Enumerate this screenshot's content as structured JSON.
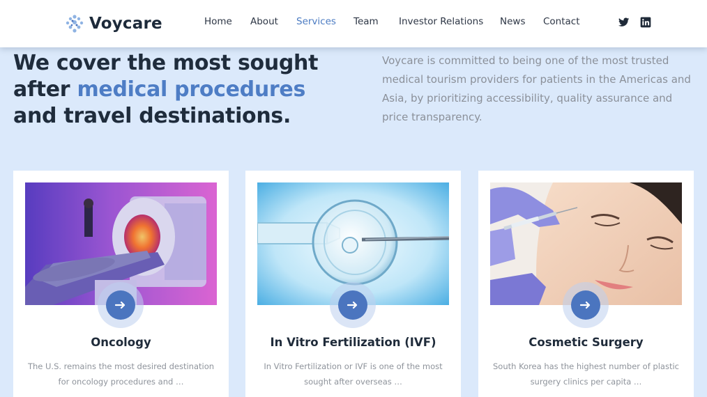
{
  "brand": {
    "name": "Voycare",
    "accent": "#4e7dc5",
    "dark": "#1f2c3c"
  },
  "nav": {
    "items": [
      "Home",
      "About",
      "Services",
      "Team",
      "Investor Relations",
      "News",
      "Contact"
    ],
    "active": "Services"
  },
  "social": {
    "twitter_icon": "twitter-icon",
    "linkedin_icon": "linkedin-icon"
  },
  "hero": {
    "title_part1": "We cover the most sought after ",
    "title_highlight": "medical procedures",
    "title_part2": " and travel destinations.",
    "description": "Voycare is committed to being one of the most trusted medical tourism providers for patients in the Americas and Asia, by prioritizing accessibility, quality assurance and price transparency."
  },
  "cards": [
    {
      "title": "Oncology",
      "text": "The U.S. remains the most desired destination for oncology procedures and …",
      "image": "mri-scanner-photo",
      "icon": "arrow-right-icon"
    },
    {
      "title": "In Vitro Fertilization (IVF)",
      "text": "In Vitro Fertilization or IVF is one of the most sought after overseas …",
      "image": "egg-cell-injection-photo",
      "icon": "arrow-right-icon"
    },
    {
      "title": "Cosmetic Surgery",
      "text": "South Korea has the highest number of plastic surgery clinics per capita …",
      "image": "cosmetic-injection-photo",
      "icon": "arrow-right-icon"
    }
  ]
}
